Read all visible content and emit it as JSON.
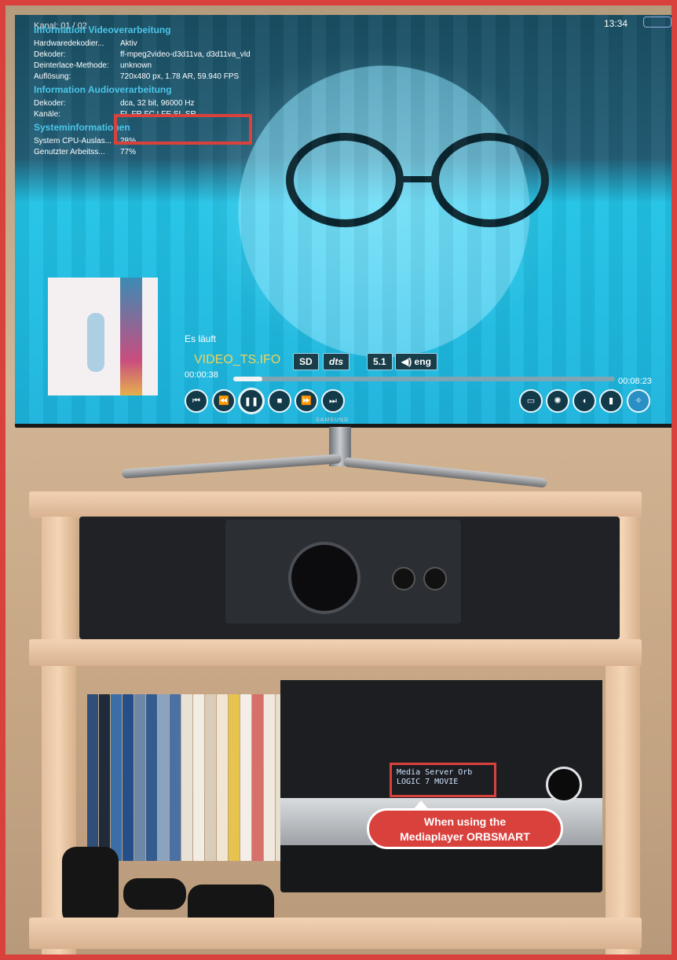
{
  "screen": {
    "channel": "Kanal: 01 / 02",
    "clock": "13:34",
    "overlay": {
      "video_title": "Information Videoverarbeitung",
      "video_rows": [
        {
          "k": "Hardwaredekodier...",
          "v": "Aktiv"
        },
        {
          "k": "Dekoder:",
          "v": "ff-mpeg2video-d3d11va, d3d11va_vld"
        },
        {
          "k": "Deinterlace-Methode:",
          "v": "unknown"
        },
        {
          "k": "Auflösung:",
          "v": "720x480 px, 1.78 AR, 59.940 FPS"
        }
      ],
      "audio_title": "Information Audioverarbeitung",
      "audio_rows": [
        {
          "k": "Dekoder:",
          "v": "dca, 32 bit, 96000 Hz"
        },
        {
          "k": "Kanäle:",
          "v": "FL,FR,FC,LFE,SL,SR"
        }
      ],
      "system_title": "Systeminformationen",
      "system_rows": [
        {
          "k": "System CPU-Auslas...",
          "v": "28%"
        },
        {
          "k": "Genutzter Arbeitss...",
          "v": "77%"
        }
      ]
    },
    "player": {
      "status": "Es läuft",
      "filename": "VIDEO_TS.IFO",
      "badges": [
        "SD",
        "dts",
        "5.1",
        "◀) eng"
      ],
      "elapsed": "00:00:38",
      "total": "00:08:23",
      "progress": 0.076,
      "controls": [
        "skip-back-icon",
        "rewind-icon",
        "pause-icon",
        "stop-icon",
        "fast-forward-icon",
        "skip-forward-icon"
      ],
      "right_controls": [
        "subtitles-icon",
        "video-settings-icon",
        "audio-settings-icon",
        "bookmark-icon",
        "menu-icon"
      ]
    }
  },
  "tv_brand": "SAMSUNG",
  "receiver": {
    "display_line1": "Media Server Orb",
    "display_line2": "LOGIC 7 MOVIE"
  },
  "callout": {
    "line1": "When using the",
    "line2": "Mediaplayer ORBSMART"
  },
  "colors": {
    "highlight": "#d9413c",
    "overlay_heading": "#49c7ea",
    "filename": "#f0d35a"
  }
}
